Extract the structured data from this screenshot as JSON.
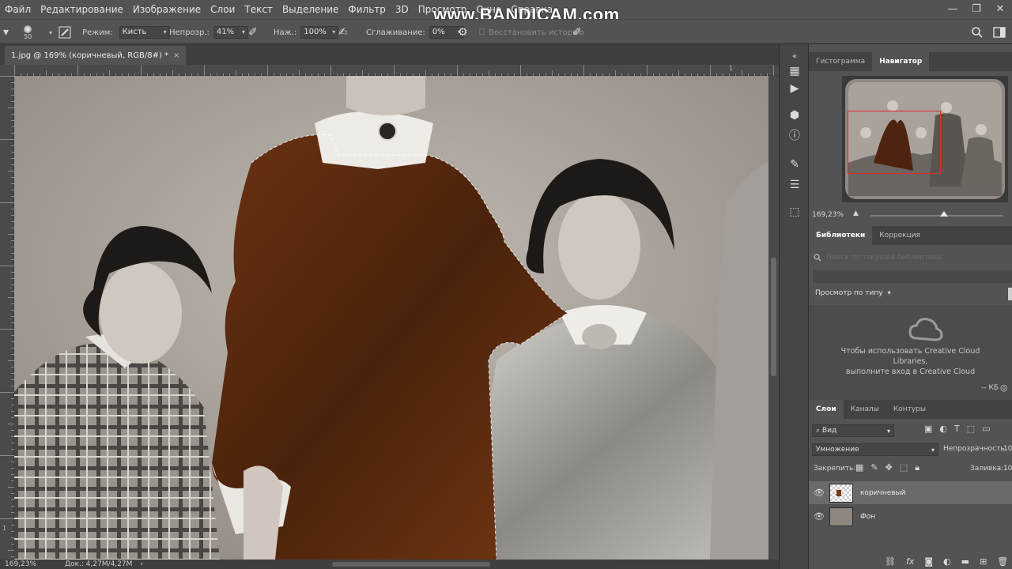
{
  "menu": [
    "Файл",
    "Редактирование",
    "Изображение",
    "Слои",
    "Текст",
    "Выделение",
    "Фильтр",
    "3D",
    "Просмотр",
    "Окно",
    "Справка"
  ],
  "watermark": "www.BANDICAM.com",
  "window_controls": {
    "minimize": "—",
    "restore": "❐",
    "close": "✕"
  },
  "options": {
    "brush_size": "50",
    "mode_label": "Режим:",
    "mode_value": "Кисть",
    "opacity_label": "Непрозр.:",
    "opacity_value": "41%",
    "pressure_label": "Наж.:",
    "pressure_value": "100%",
    "smoothing_label": "Сглаживание:",
    "smoothing_value": "0%",
    "history_label": "Восстановить историю"
  },
  "document": {
    "tab_title": "1.jpg @ 169% (коричневый, RGB/8#) *",
    "close": "×",
    "ruler_mark": "1"
  },
  "status": {
    "zoom": "169,23%",
    "doc": "Док.: 4,27M/4,27M"
  },
  "navigator": {
    "tabs": [
      "Гистограмма",
      "Навигатор"
    ],
    "active_tab": 1,
    "zoom": "169,23%"
  },
  "libraries": {
    "tabs": [
      "Библиотеки",
      "Коррекция"
    ],
    "active_tab": 0,
    "search_placeholder": "Поиск по текущей библиотеке",
    "view_by": "Просмотр по типу",
    "message_line1": "Чтобы использовать Creative Cloud",
    "message_line2": "Libraries,",
    "message_line3": "выполните вход в Creative Cloud",
    "size": "-- КБ"
  },
  "layers": {
    "tabs": [
      "Слои",
      "Каналы",
      "Контуры"
    ],
    "active_tab": 0,
    "filter_kind": "Вид",
    "blend_mode": "Умножение",
    "opacity_label": "Непрозрачность:",
    "opacity_value": "10",
    "lock_label": "Закрепить:",
    "fill_label": "Заливка:",
    "fill_value": "10",
    "items": [
      {
        "name": "коричневый",
        "selected": true
      },
      {
        "name": "Фон",
        "selected": false
      }
    ]
  },
  "colors": {
    "ui_bg": "#535353",
    "dress_brown": "#5b2a10",
    "nav_rect": "#e02b2b"
  }
}
